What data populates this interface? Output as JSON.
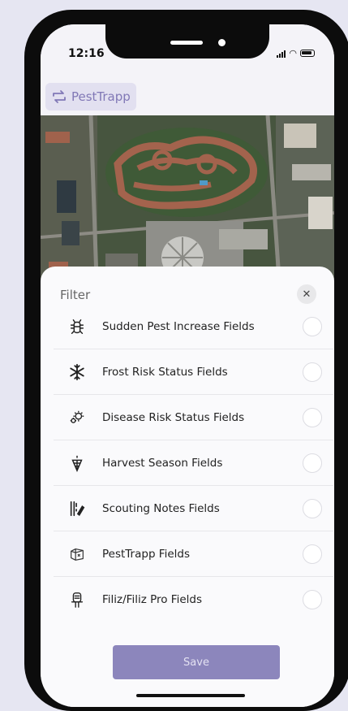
{
  "status": {
    "time": "12:16"
  },
  "app": {
    "name": "PestTrapp"
  },
  "filter": {
    "title": "Filter",
    "items": [
      {
        "label": "Sudden Pest Increase Fields",
        "icon": "bug-icon"
      },
      {
        "label": "Frost Risk Status Fields",
        "icon": "snowflake-icon"
      },
      {
        "label": "Disease Risk Status Fields",
        "icon": "virus-icon"
      },
      {
        "label": "Harvest Season Fields",
        "icon": "grapes-icon"
      },
      {
        "label": "Scouting Notes Fields",
        "icon": "notes-pen-icon"
      },
      {
        "label": "PestTrapp Fields",
        "icon": "trap-icon"
      },
      {
        "label": "Filiz/Filiz Pro Fields",
        "icon": "sensor-icon"
      }
    ],
    "save_label": "Save"
  },
  "colors": {
    "accent": "#8c86bc",
    "logo": "#8178b6",
    "background": "#e6e6f2"
  }
}
